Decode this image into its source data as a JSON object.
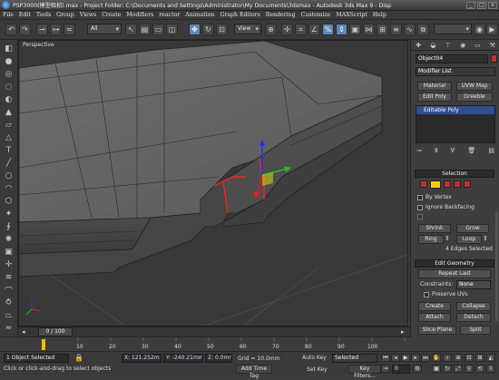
{
  "window": {
    "title": "PSP3000(模型临拍).max  - Project Folder: C:\\Documents and Settings\\Administrator\\My Documents\\3dsmax   - Autodesk 3ds Max 9    - Disp",
    "min": "_",
    "max": "□",
    "close": "×"
  },
  "menu": [
    "File",
    "Edit",
    "Tools",
    "Group",
    "Views",
    "Create",
    "Modifiers",
    "reactor",
    "Animation",
    "Graph Editors",
    "Rendering",
    "Customize",
    "MAXScript",
    "Help"
  ],
  "toolbar": {
    "filter_value": "All",
    "refcoord_value": "View"
  },
  "viewport": {
    "label": "Perspective"
  },
  "command_panel": {
    "object_name": "Object04",
    "modifier_list": "Modifier List",
    "buttons": [
      "Material",
      "UVW Map",
      "Edit Poly",
      "Greeble"
    ],
    "stack_item": "Editable Poly",
    "selection": {
      "header": "Selection",
      "by_vertex": "By Vertex",
      "ignore_backfacing": "Ignore Backfacing",
      "shrink": "Shrink",
      "grow": "Grow",
      "ring": "Ring",
      "loop": "Loop",
      "status": "4 Edges Selected"
    },
    "edit_geometry": {
      "header": "Edit Geometry",
      "repeat_last": "Repeat Last",
      "constraints_label": "Constraints:",
      "constraints_value": "None",
      "preserve_uvs": "Preserve UVs",
      "create": "Create",
      "collapse": "Collapse",
      "attach": "Attach",
      "detach": "Detach",
      "slice_plane": "Slice Plane",
      "split": "Split"
    }
  },
  "timeline": {
    "frame": "0 / 100",
    "ticks": [
      "10",
      "20",
      "30",
      "40",
      "50",
      "60",
      "70",
      "80",
      "90",
      "100"
    ]
  },
  "status": {
    "selected": "1 Object Selected",
    "prompt": "Click or click-and-drag to select objects",
    "x": "X: 121.252m",
    "y": "Y: -240.21mm",
    "z": "Z: 0.0mm",
    "grid": "Grid = 10.0mm",
    "add_time_tag": "Add Time Tag",
    "auto_key": "Auto Key",
    "set_key": "Set Key",
    "key_mode": "Selected",
    "key_filters": "Key Filters...",
    "frame_field": "0"
  },
  "colors": {
    "selection_red": "#ff2020",
    "gizmo_x": "#e02020",
    "gizmo_y": "#20c020",
    "gizmo_z": "#2030ff",
    "stack_highlight": "#2f4f8f"
  }
}
